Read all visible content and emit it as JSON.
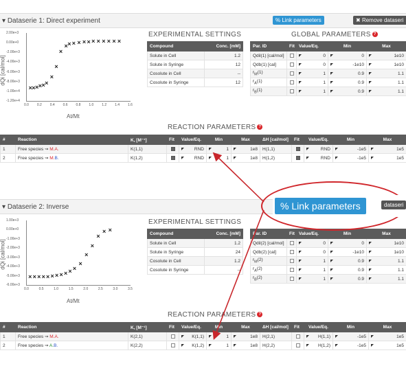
{
  "s1": {
    "title": "Dataserie 1: Direct experiment",
    "link_label": "Link parameters",
    "remove_label": "Remove dataseri",
    "exp_title": "EXPERIMENTAL SETTINGS",
    "glob_title": "GLOBAL PARAMETERS",
    "react_title": "REACTION PARAMETERS",
    "exp_head": [
      "Compound",
      "Conc. [mM]"
    ],
    "exp_rows": [
      [
        "Solute in Cell",
        "1.2"
      ],
      [
        "Solute in Syringe",
        "12"
      ],
      [
        "Cosolute in Cell",
        "--"
      ],
      [
        "Cosolute in Syringe",
        "12"
      ]
    ],
    "glob_head": [
      "Par. ID",
      "Fit",
      "Value/Eq.",
      "Min",
      "Max"
    ],
    "glob_rows": [
      {
        "id": "Qdil(1) [cal/mol]",
        "fit": false,
        "val": "0",
        "min": "0",
        "max": "1e10"
      },
      {
        "id": "Qdb(1) [cal]",
        "fit": false,
        "val": "0",
        "min": "-1e10",
        "max": "1e10"
      },
      {
        "id": "r_M(1)",
        "fit": false,
        "val": "1",
        "min": "0.9",
        "max": "1.1"
      },
      {
        "id": "r_A(1)",
        "fit": false,
        "val": "1",
        "min": "0.9",
        "max": "1.1"
      },
      {
        "id": "r_B(1)",
        "fit": false,
        "val": "1",
        "min": "0.9",
        "max": "1.1"
      }
    ],
    "react_head": [
      "#",
      "Reaction",
      "K, [M⁻¹]",
      "Fit",
      "Value/Eq.",
      "Min",
      "Max",
      "ΔH [cal/mol]",
      "Fit",
      "Value/Eq.",
      "Min",
      "Max"
    ],
    "react_rows": [
      {
        "n": "1",
        "rxn": "Free species ⇝ ",
        "prod": "M.A.",
        "k": "K(1,1)",
        "kfit": true,
        "kval": "RND",
        "kmin": "1",
        "kmax": "1e8",
        "h": "H(1,1)",
        "hfit": true,
        "hval": "RND",
        "hmin": "-1e5",
        "hmax": "1e5"
      },
      {
        "n": "2",
        "rxn": "Free species ⇝ ",
        "prod": "M.B.",
        "k": "K(1,2)",
        "kfit": true,
        "kval": "RND",
        "kmin": "1",
        "kmax": "1e8",
        "h": "H(1,2)",
        "hfit": true,
        "hval": "RND",
        "hmin": "-1e5",
        "hmax": "1e5"
      }
    ],
    "chart_yticks": [
      "2.00e+3",
      "0.00e+0",
      "-2.00e+3",
      "-4.00e+3",
      "-6.00e+3",
      "-8.00e+3",
      "-1.00e+4",
      "-1.20e+4"
    ],
    "chart_xticks": [
      "0.0",
      "0.2",
      "0.4",
      "0.6",
      "0.8",
      "1.0",
      "1.2",
      "1.4",
      "1.6"
    ],
    "ylabel": "dQi [cal/mol]",
    "xlabel": "At/Mt"
  },
  "s2": {
    "title": "Dataserie 2: Inverse",
    "link_label": "Link parameters",
    "remove_label": "dataseri",
    "exp_title": "EXPERIMENTAL SETTINGS",
    "react_title": "REACTION PARAMETERS",
    "exp_head": [
      "Compound",
      "Conc. [mM]"
    ],
    "exp_rows": [
      [
        "Solute in Cell",
        "1.2"
      ],
      [
        "Solute in Syringe",
        "24"
      ],
      [
        "Cosolute in Cell",
        "1.2"
      ],
      [
        "Cosolute in Syringe",
        "--"
      ]
    ],
    "glob_head": [
      "Par. ID",
      "Fit",
      "Value/Eq.",
      "Min",
      "Max"
    ],
    "glob_rows": [
      {
        "id": "Qdil(2) [cal/mol]",
        "fit": false,
        "val": "0",
        "min": "0",
        "max": "1e10"
      },
      {
        "id": "Qdb(2) [cal]",
        "fit": false,
        "val": "0",
        "min": "-1e10",
        "max": "1e10"
      },
      {
        "id": "r_M(2)",
        "fit": false,
        "val": "1",
        "min": "0.9",
        "max": "1.1"
      },
      {
        "id": "r_A(2)",
        "fit": false,
        "val": "1",
        "min": "0.9",
        "max": "1.1"
      },
      {
        "id": "r_B(2)",
        "fit": false,
        "val": "1",
        "min": "0.9",
        "max": "1.1"
      }
    ],
    "react_head": [
      "#",
      "Reaction",
      "K, [M⁻¹]",
      "Fit",
      "Value/Eq.",
      "Min",
      "Max",
      "ΔH [cal/mol]",
      "Fit",
      "Value/Eq.",
      "Min",
      "Max"
    ],
    "react_rows": [
      {
        "n": "1",
        "rxn": "Free species ⇝ ",
        "prod": "M.A.",
        "k": "K(2,1)",
        "kfit": false,
        "kval": "K(1,1)",
        "kmin": "1",
        "kmax": "1e8",
        "h": "H(2,1)",
        "hfit": false,
        "hval": "H(1,1)",
        "hmin": "-1e5",
        "hmax": "1e5"
      },
      {
        "n": "2",
        "rxn": "Free species ⇝ ",
        "prod": "A.B.",
        "k": "K(2,2)",
        "kfit": false,
        "kval": "K(1,2)",
        "kmin": "1",
        "kmax": "1e8",
        "h": "H(2,2)",
        "hfit": false,
        "hval": "H(1,2)",
        "hmin": "-1e5",
        "hmax": "1e5"
      }
    ],
    "chart_yticks": [
      "1.00e+3",
      "0.00e+0",
      "-1.00e+3",
      "-2.00e+3",
      "-3.00e+3",
      "-4.00e+3",
      "-5.00e+3",
      "-6.00e+3"
    ],
    "chart_xticks": [
      "0.0",
      "0.5",
      "1.0",
      "1.5",
      "2.0",
      "2.5",
      "3.0",
      "3.5"
    ],
    "ylabel": "dQi [cal/mol]",
    "xlabel": "At/Mt"
  },
  "callout": {
    "link_label": "Link parameters",
    "remove_label": "dataseri"
  },
  "chart_data": [
    {
      "type": "scatter",
      "xlabel": "At/Mt",
      "ylabel": "dQi [cal/mol]",
      "ylim": [
        -12000,
        2000
      ],
      "xlim": [
        0,
        1.6
      ],
      "x": [
        0.05,
        0.1,
        0.15,
        0.2,
        0.25,
        0.3,
        0.38,
        0.45,
        0.52,
        0.6,
        0.65,
        0.72,
        0.8,
        0.88,
        0.95,
        1.02,
        1.1,
        1.18,
        1.26,
        1.34,
        1.42
      ],
      "y": [
        -9500,
        -9400,
        -9300,
        -9100,
        -8900,
        -8500,
        -7200,
        -5000,
        -2000,
        -800,
        -400,
        -200,
        -100,
        0,
        50,
        100,
        120,
        150,
        180,
        200,
        220
      ]
    },
    {
      "type": "scatter",
      "xlabel": "At/Mt",
      "ylabel": "dQi [cal/mol]",
      "ylim": [
        -6000,
        1000
      ],
      "xlim": [
        0,
        3.5
      ],
      "x": [
        0.1,
        0.25,
        0.4,
        0.55,
        0.7,
        0.85,
        1.0,
        1.15,
        1.3,
        1.45,
        1.6,
        1.8,
        2.0,
        2.2,
        2.4,
        2.6,
        2.8
      ],
      "y": [
        -5200,
        -5200,
        -5200,
        -5200,
        -5150,
        -5100,
        -5050,
        -4950,
        -4800,
        -4600,
        -4300,
        -3800,
        -2800,
        -1800,
        -800,
        -300,
        -150
      ]
    }
  ]
}
